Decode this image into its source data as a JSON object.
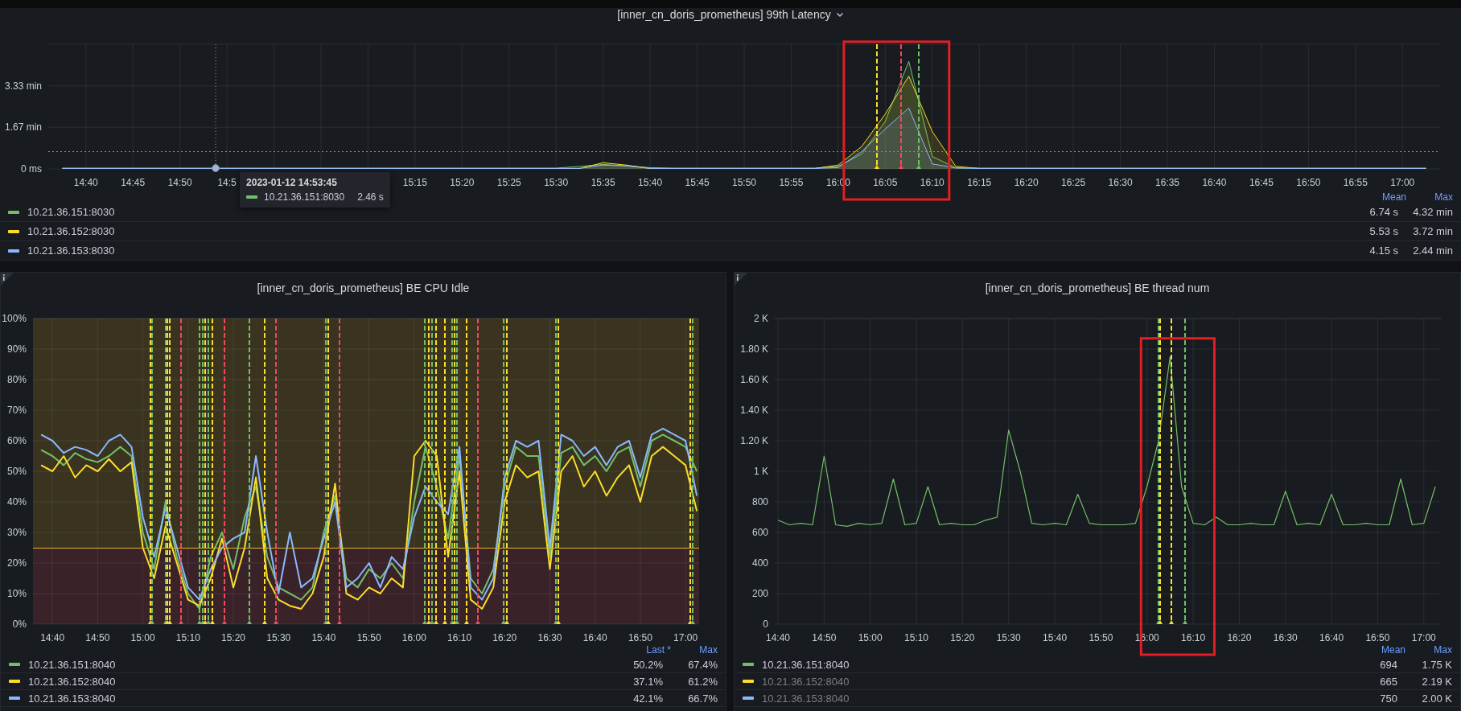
{
  "panels": [
    {
      "title": "[inner_cn_doris_prometheus] 99th Latency",
      "menu": true,
      "info": false,
      "chart_data": {
        "type": "area",
        "categories": [
          null,
          "14:40",
          null,
          "14:45",
          null,
          "14:50",
          null,
          "14:5",
          null,
          null,
          null,
          null,
          null,
          null,
          null,
          "15:15",
          null,
          "15:20",
          null,
          "15:25",
          null,
          "15:30",
          null,
          "15:35",
          null,
          "15:40",
          null,
          "15:45",
          null,
          "15:50",
          null,
          "15:55",
          null,
          "16:00",
          null,
          "16:05",
          null,
          "16:10",
          null,
          "16:15",
          null,
          "16:20",
          null,
          "16:25",
          null,
          "16:30",
          null,
          "16:35",
          null,
          "16:40",
          null,
          "16:45",
          null,
          "16:50",
          null,
          "16:55",
          null,
          "17:00",
          null
        ],
        "series": [
          {
            "color": "#73bf69",
            "values": [
              0.03,
              0.03,
              0.03,
              0.03,
              0.03,
              0.03,
              0.03,
              0.03,
              0.03,
              0.03,
              0.03,
              0.03,
              0.03,
              0.03,
              0.03,
              0.03,
              0.03,
              0.03,
              0.03,
              0.03,
              0.03,
              0.03,
              0.1,
              0.18,
              0.12,
              0.05,
              0.03,
              0.03,
              0.03,
              0.03,
              0.03,
              0.03,
              0.03,
              0.1,
              0.6,
              1.9,
              4.32,
              0.5,
              0.04,
              0.03,
              0.03,
              0.03,
              0.03,
              0.03,
              0.03,
              0.03,
              0.03,
              0.03,
              0.03,
              0.03,
              0.03,
              0.03,
              0.03,
              0.03,
              0.03,
              0.03,
              0.03,
              0.03,
              0.03
            ]
          },
          {
            "color": "#fade2a",
            "values": [
              0.02,
              0.02,
              0.02,
              0.02,
              0.02,
              0.02,
              0.02,
              0.02,
              0.02,
              0.02,
              0.02,
              0.02,
              0.02,
              0.02,
              0.02,
              0.02,
              0.02,
              0.02,
              0.02,
              0.02,
              0.02,
              0.02,
              0.02,
              0.25,
              0.15,
              0.02,
              0.02,
              0.02,
              0.02,
              0.02,
              0.02,
              0.02,
              0.02,
              0.15,
              0.9,
              2.2,
              3.72,
              1.5,
              0.1,
              0.02,
              0.02,
              0.02,
              0.02,
              0.02,
              0.02,
              0.02,
              0.02,
              0.02,
              0.02,
              0.02,
              0.02,
              0.02,
              0.02,
              0.02,
              0.02,
              0.02,
              0.02,
              0.02,
              0.02
            ]
          },
          {
            "color": "#8ab8ff",
            "values": [
              0.02,
              0.02,
              0.02,
              0.02,
              0.02,
              0.02,
              0.02,
              0.02,
              0.02,
              0.02,
              0.02,
              0.02,
              0.02,
              0.02,
              0.02,
              0.02,
              0.02,
              0.02,
              0.02,
              0.02,
              0.02,
              0.02,
              0.02,
              0.15,
              0.12,
              0.02,
              0.02,
              0.02,
              0.02,
              0.02,
              0.02,
              0.02,
              0.02,
              0.05,
              0.7,
              1.6,
              2.44,
              0.2,
              0.04,
              0.02,
              0.02,
              0.02,
              0.02,
              0.02,
              0.02,
              0.02,
              0.02,
              0.02,
              0.02,
              0.02,
              0.02,
              0.02,
              0.02,
              0.02,
              0.02,
              0.02,
              0.02,
              0.02,
              0.02
            ]
          }
        ],
        "ylim": [
          0,
          5
        ],
        "yticks": [
          {
            "value": 0,
            "label": "0 ms"
          },
          {
            "value": 1.67,
            "label": "1.67 min"
          },
          {
            "value": 3.33,
            "label": "3.33 min"
          }
        ],
        "grid": true,
        "ref_lines": [
          {
            "axis": "y",
            "value": 0.7,
            "color": "#8e8e8e"
          }
        ]
      },
      "markers": [
        {
          "color": "#fade2a"
        },
        {
          "color": "#f2495c"
        },
        {
          "color": "#73bf69"
        }
      ],
      "highlight": {
        "color": "#e31e24"
      },
      "tooltip": {
        "time": "2023-01-12 14:53:45",
        "rows": [
          {
            "name": "10.21.36.151:8030",
            "value": "2.46 s",
            "color": "#73bf69"
          }
        ]
      },
      "legend": {
        "columns": [
          "Mean",
          "Max"
        ],
        "rows": [
          {
            "name": "10.21.36.151:8030",
            "color": "#73bf69",
            "hidden": false,
            "values": [
              "6.74 s",
              "4.32 min"
            ]
          },
          {
            "name": "10.21.36.152:8030",
            "color": "#fade2a",
            "hidden": false,
            "values": [
              "5.53 s",
              "3.72 min"
            ]
          },
          {
            "name": "10.21.36.153:8030",
            "color": "#8ab8ff",
            "hidden": false,
            "values": [
              "4.15 s",
              "2.44 min"
            ]
          }
        ]
      }
    },
    {
      "title": "[inner_cn_doris_prometheus] BE CPU Idle",
      "menu": false,
      "info": true,
      "chart_data": {
        "type": "line",
        "categories": [
          null,
          "14:40",
          null,
          null,
          null,
          "14:50",
          null,
          null,
          null,
          "15:00",
          null,
          null,
          null,
          "15:10",
          null,
          null,
          null,
          "15:20",
          null,
          null,
          null,
          "15:30",
          null,
          null,
          null,
          "15:40",
          null,
          null,
          null,
          "15:50",
          null,
          null,
          null,
          "16:00",
          null,
          null,
          null,
          "16:10",
          null,
          null,
          null,
          "16:20",
          null,
          null,
          null,
          "16:30",
          null,
          null,
          null,
          "16:40",
          null,
          null,
          null,
          "16:50",
          null,
          null,
          null,
          "17:00",
          null
        ],
        "series": [
          {
            "color": "#73bf69",
            "values": [
              57,
              55,
              52,
              56,
              54,
              53,
              55,
              58,
              55,
              30,
              18,
              40,
              22,
              10,
              5,
              22,
              30,
              18,
              35,
              45,
              22,
              12,
              10,
              8,
              12,
              30,
              42,
              15,
              12,
              18,
              15,
              20,
              15,
              40,
              58,
              45,
              28,
              55,
              15,
              10,
              18,
              45,
              58,
              55,
              55,
              22,
              56,
              58,
              52,
              55,
              50,
              56,
              58,
              45,
              60,
              62,
              60,
              58,
              50
            ]
          },
          {
            "color": "#fade2a",
            "values": [
              52,
              50,
              55,
              48,
              52,
              50,
              54,
              50,
              53,
              25,
              15,
              32,
              20,
              8,
              6,
              15,
              28,
              12,
              25,
              48,
              15,
              8,
              6,
              5,
              10,
              22,
              46,
              10,
              8,
              12,
              10,
              15,
              12,
              55,
              60,
              55,
              22,
              50,
              8,
              5,
              12,
              40,
              52,
              48,
              50,
              18,
              50,
              55,
              45,
              50,
              42,
              48,
              52,
              40,
              55,
              58,
              55,
              52,
              37
            ]
          },
          {
            "color": "#8ab8ff",
            "values": [
              62,
              60,
              56,
              58,
              57,
              55,
              60,
              62,
              58,
              35,
              22,
              38,
              25,
              12,
              8,
              18,
              25,
              28,
              30,
              55,
              30,
              10,
              30,
              12,
              15,
              28,
              40,
              12,
              15,
              20,
              12,
              22,
              18,
              35,
              45,
              40,
              36,
              58,
              12,
              8,
              15,
              48,
              60,
              58,
              60,
              25,
              62,
              60,
              55,
              58,
              52,
              58,
              60,
              48,
              62,
              64,
              62,
              60,
              42
            ]
          }
        ],
        "ylim": [
          0,
          100
        ],
        "yticks": [
          {
            "value": 0,
            "label": "0%"
          },
          {
            "value": 10,
            "label": "10%"
          },
          {
            "value": 20,
            "label": "20%"
          },
          {
            "value": 30,
            "label": "30%"
          },
          {
            "value": 40,
            "label": "40%"
          },
          {
            "value": 50,
            "label": "50%"
          },
          {
            "value": 60,
            "label": "60%"
          },
          {
            "value": 70,
            "label": "70%"
          },
          {
            "value": 80,
            "label": "80%"
          },
          {
            "value": 90,
            "label": "90%"
          },
          {
            "value": 100,
            "label": "100%"
          }
        ],
        "grid": true,
        "bands": [
          {
            "axis": "y",
            "from": 25,
            "to": 100,
            "color": "#39331f"
          },
          {
            "axis": "y",
            "from": 0,
            "to": 25,
            "color": "#3a2229"
          }
        ],
        "ref_lines": [
          {
            "axis": "y",
            "value": 25,
            "color": "#e0b62c"
          }
        ]
      },
      "markers": [
        {
          "color": "#fade2a"
        },
        {
          "color": "#73bf69"
        },
        {
          "color": "#73bf69"
        },
        {
          "color": "#fade2a"
        },
        {
          "color": "#fade2a"
        },
        {
          "color": "#f2495c"
        },
        {
          "color": "#73bf69"
        },
        {
          "color": "#73bf69"
        },
        {
          "color": "#fade2a"
        },
        {
          "color": "#73bf69"
        },
        {
          "color": "#fade2a"
        },
        {
          "color": "#f2495c"
        },
        {
          "color": "#73bf69"
        },
        {
          "color": "#fade2a"
        },
        {
          "color": "#f2495c"
        },
        {
          "color": "#73bf69"
        },
        {
          "color": "#fade2a"
        },
        {
          "color": "#f2495c"
        },
        {
          "color": "#73bf69"
        },
        {
          "color": "#fade2a"
        },
        {
          "color": "#73bf69"
        },
        {
          "color": "#fade2a"
        },
        {
          "color": "#fade2a"
        },
        {
          "color": "#73bf69"
        },
        {
          "color": "#fade2a"
        },
        {
          "color": "#73bf69"
        },
        {
          "color": "#fade2a"
        },
        {
          "color": "#f2495c"
        },
        {
          "color": "#73bf69"
        },
        {
          "color": "#fade2a"
        },
        {
          "color": "#73bf69"
        },
        {
          "color": "#fade2a"
        },
        {
          "color": "#fade2a"
        },
        {
          "color": "#73bf69"
        }
      ],
      "legend": {
        "columns": [
          "Last *",
          "Max"
        ],
        "rows": [
          {
            "name": "10.21.36.151:8040",
            "color": "#73bf69",
            "hidden": false,
            "values": [
              "50.2%",
              "67.4%"
            ]
          },
          {
            "name": "10.21.36.152:8040",
            "color": "#fade2a",
            "hidden": false,
            "values": [
              "37.1%",
              "61.2%"
            ]
          },
          {
            "name": "10.21.36.153:8040",
            "color": "#8ab8ff",
            "hidden": false,
            "values": [
              "42.1%",
              "66.7%"
            ]
          }
        ]
      }
    },
    {
      "title": "[inner_cn_doris_prometheus] BE thread num",
      "menu": false,
      "info": true,
      "chart_data": {
        "type": "line",
        "categories": [
          "14:40",
          null,
          null,
          null,
          "14:50",
          null,
          null,
          null,
          "15:00",
          null,
          null,
          null,
          "15:10",
          null,
          null,
          null,
          "15:20",
          null,
          null,
          null,
          "15:30",
          null,
          null,
          null,
          "15:40",
          null,
          null,
          null,
          "15:50",
          null,
          null,
          null,
          "16:00",
          null,
          null,
          null,
          "16:10",
          null,
          null,
          null,
          "16:20",
          null,
          null,
          null,
          "16:30",
          null,
          null,
          null,
          "16:40",
          null,
          null,
          null,
          "16:50",
          null,
          null,
          null,
          "17:00",
          null
        ],
        "series": [
          {
            "color": "#73bf69",
            "values": [
              680,
              650,
              660,
              650,
              1100,
              650,
              640,
              660,
              650,
              660,
              950,
              650,
              660,
              900,
              650,
              660,
              650,
              650,
              680,
              700,
              1270,
              1000,
              660,
              650,
              660,
              650,
              850,
              660,
              650,
              650,
              650,
              660,
              900,
              1200,
              1750,
              900,
              660,
              650,
              700,
              650,
              650,
              660,
              650,
              650,
              870,
              650,
              660,
              650,
              850,
              650,
              650,
              660,
              650,
              650,
              950,
              650,
              660,
              900
            ]
          }
        ],
        "ylim": [
          0,
          2000
        ],
        "yticks": [
          0,
          200,
          400,
          600,
          800,
          {
            "value": 1000,
            "label": "1 K"
          },
          {
            "value": 1200,
            "label": "1.20 K"
          },
          {
            "value": 1400,
            "label": "1.40 K"
          },
          {
            "value": 1600,
            "label": "1.60 K"
          },
          {
            "value": 1800,
            "label": "1.80 K"
          },
          {
            "value": 2000,
            "label": "2 K"
          }
        ],
        "grid": true
      },
      "markers": [
        {
          "color": "#73bf69"
        },
        {
          "color": "#fade2a"
        },
        {
          "color": "#fade2a"
        },
        {
          "color": "#73bf69"
        }
      ],
      "highlight": {
        "color": "#e31e24"
      },
      "legend": {
        "columns": [
          "Mean",
          "Max"
        ],
        "rows": [
          {
            "name": "10.21.36.151:8040",
            "color": "#73bf69",
            "hidden": false,
            "values": [
              "694",
              "1.75 K"
            ]
          },
          {
            "name": "10.21.36.152:8040",
            "color": "#fade2a",
            "hidden": true,
            "values": [
              "665",
              "2.19 K"
            ]
          },
          {
            "name": "10.21.36.153:8040",
            "color": "#8ab8ff",
            "hidden": true,
            "values": [
              "750",
              "2.00 K"
            ]
          }
        ]
      }
    }
  ]
}
